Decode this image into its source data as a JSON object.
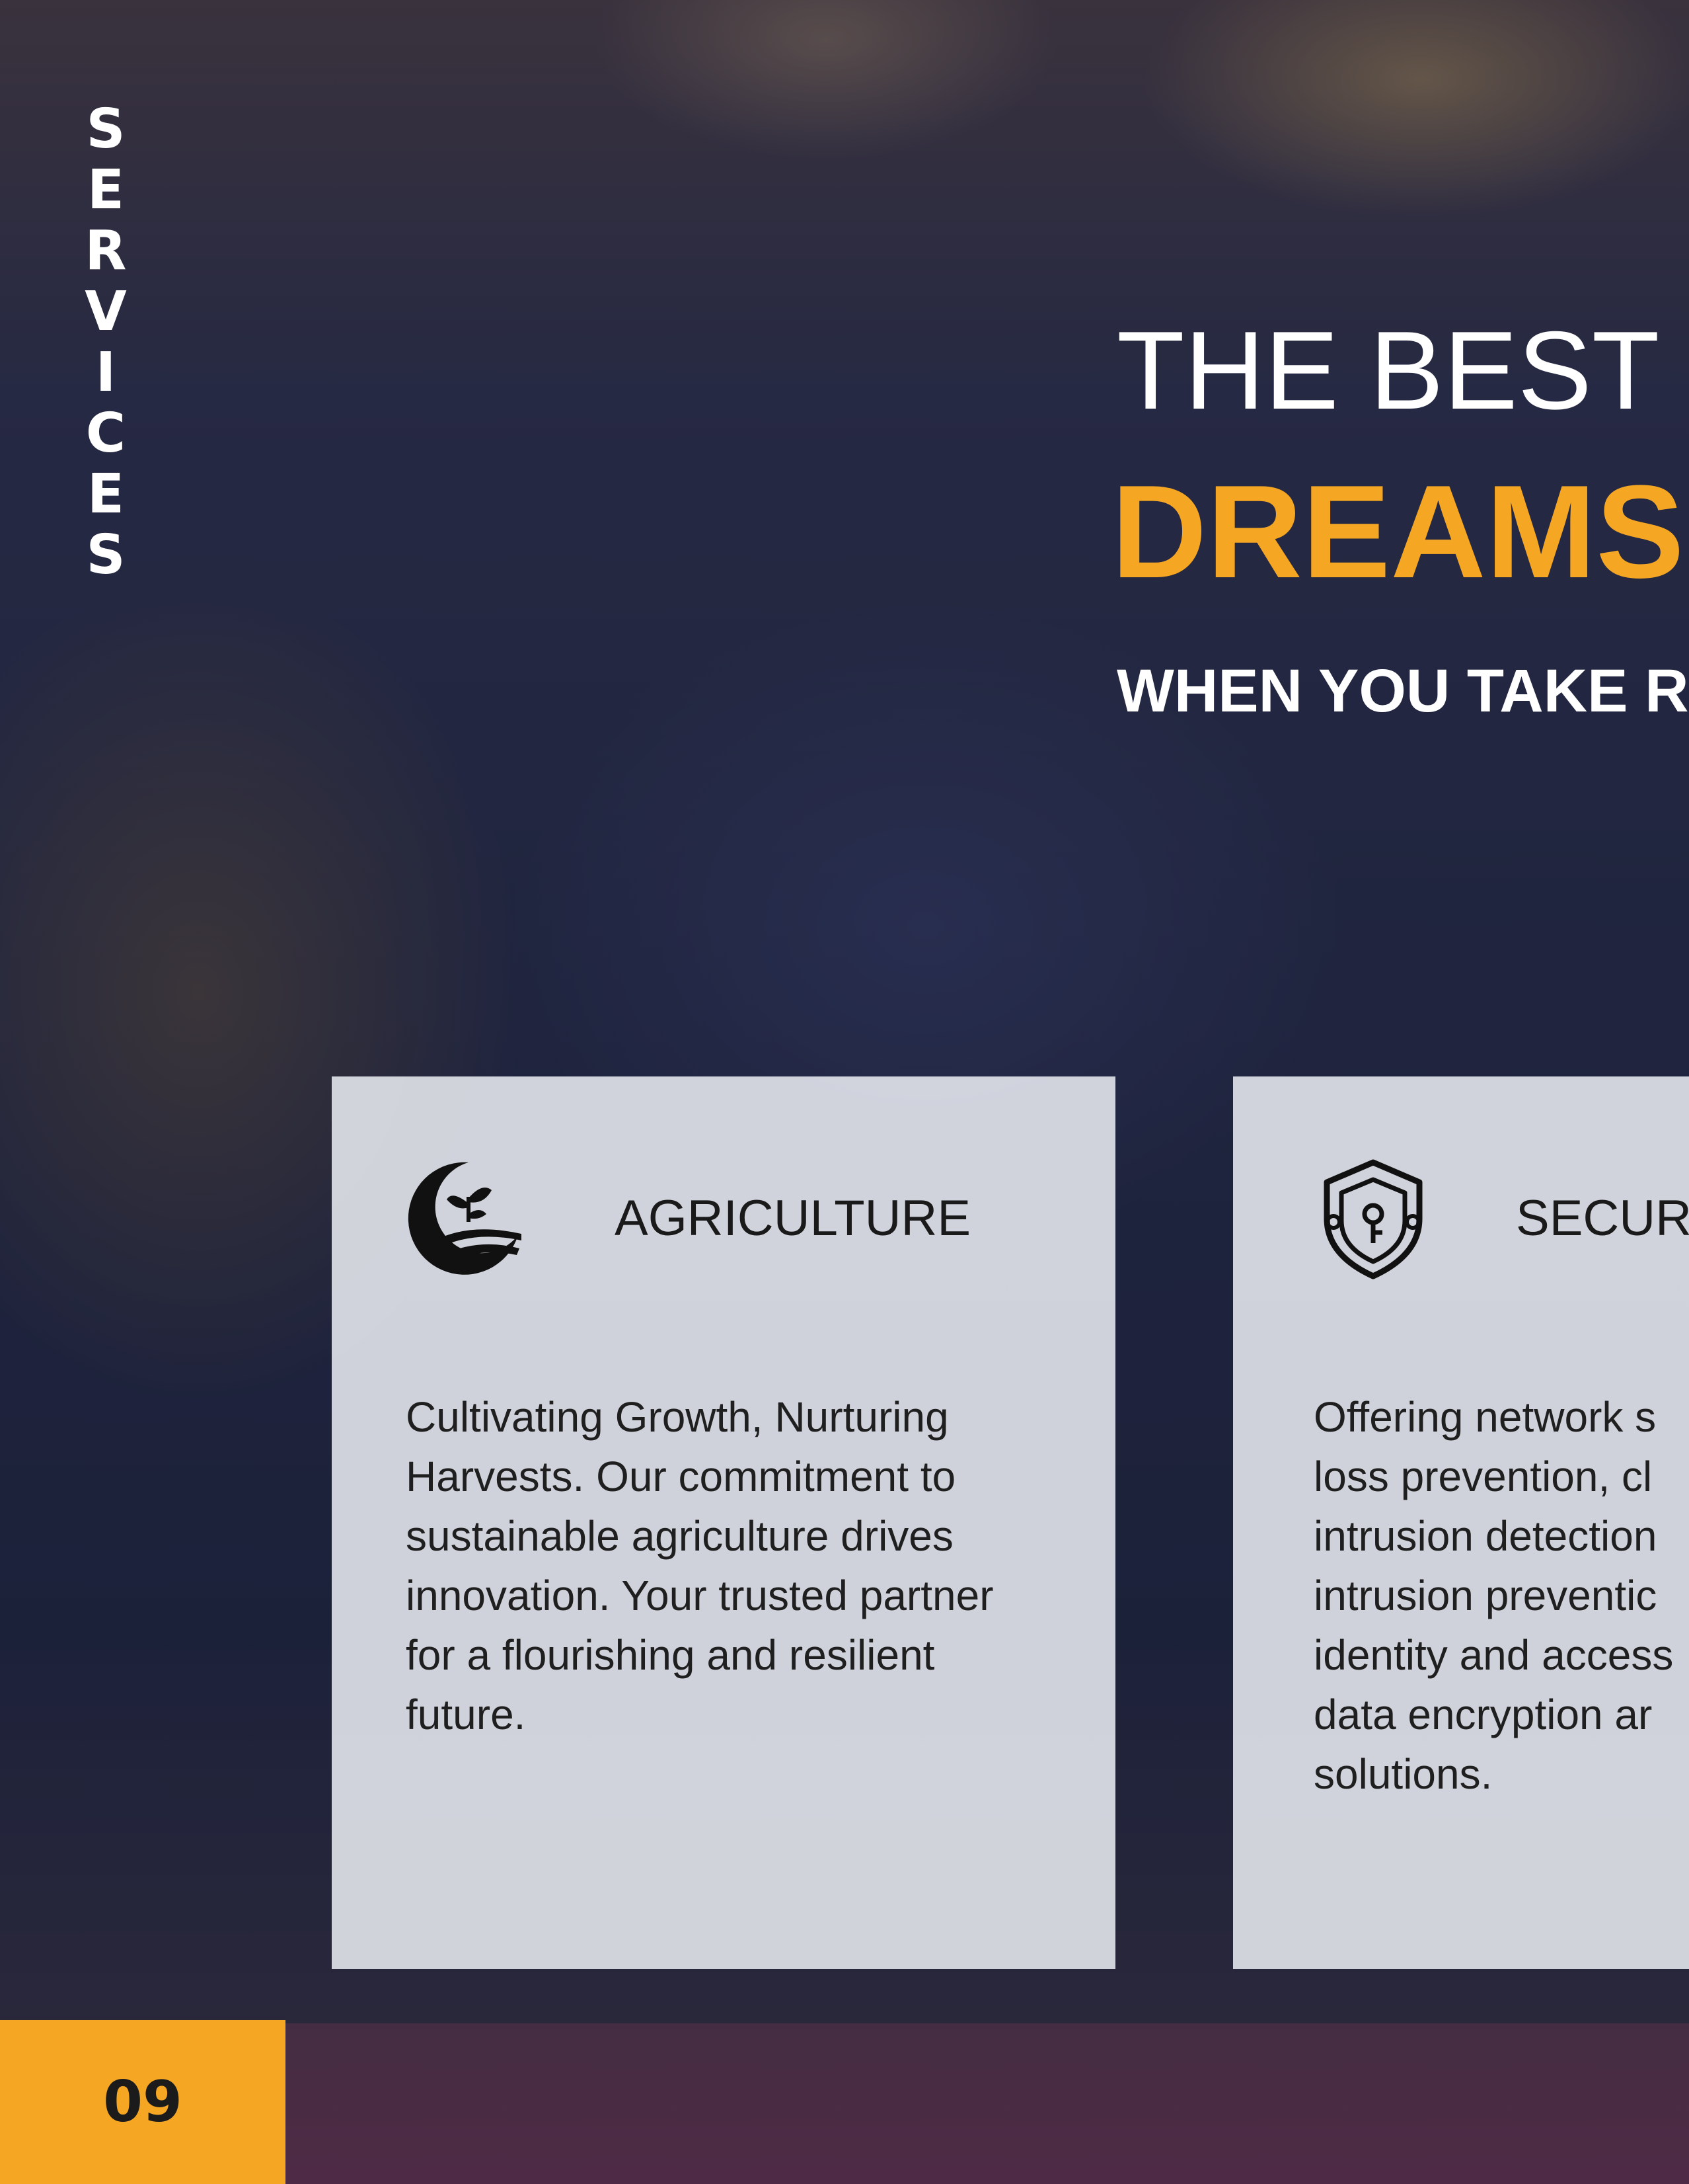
{
  "sidebar": {
    "vertical_label_letters": [
      "S",
      "E",
      "R",
      "V",
      "I",
      "C",
      "E",
      "S"
    ]
  },
  "headline": {
    "line1": "THE BEST",
    "line2": "DREAMS",
    "line3": "WHEN YOU TAKE RIS"
  },
  "cards": [
    {
      "icon": "agriculture-icon",
      "title": "AGRICULTURE",
      "body": "Cultivating Growth, Nurturing\nHarvests. Our commitment to\nsustainable agriculture drives\ninnovation. Your trusted partner\nfor a flourishing and resilient\nfuture."
    },
    {
      "icon": "security-shield-icon",
      "title": "SECURI",
      "body": "Offering network s\nloss prevention, cl\nintrusion detection\nintrusion preventic\nidentity and access\ndata encryption ar\nsolutions."
    }
  ],
  "footer": {
    "page_number": "09"
  },
  "colors": {
    "accent": "#f5a623",
    "card_bg": "#eef0f6",
    "headline_white": "#ffffff",
    "overlay_navy": "#1e2240"
  }
}
